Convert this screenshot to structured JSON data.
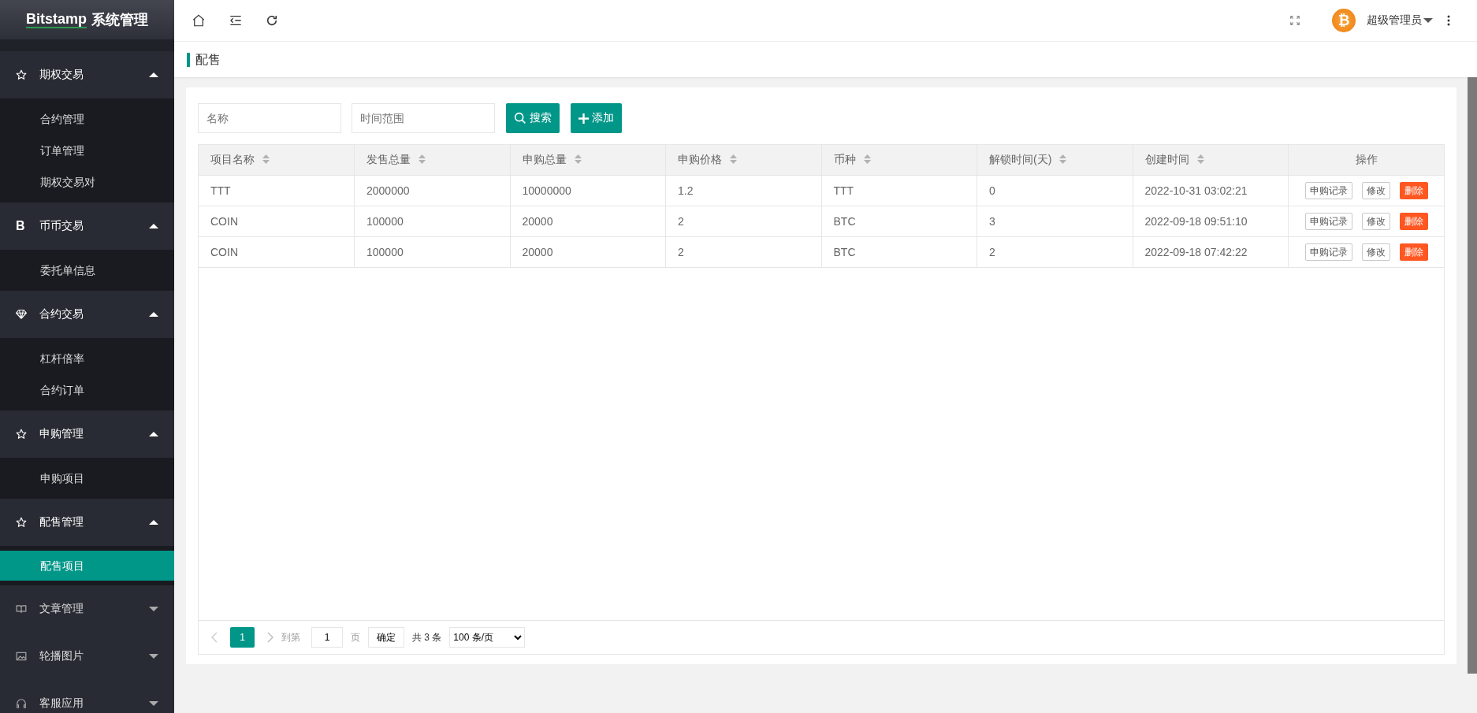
{
  "sidebar": {
    "logo": {
      "brand": "Bitstamp",
      "suffix": "系统管理"
    },
    "groups": [
      {
        "label": "期权交易",
        "kind": "star",
        "expanded": true,
        "children": [
          {
            "label": "合约管理",
            "selected": false
          },
          {
            "label": "订单管理",
            "selected": false
          },
          {
            "label": "期权交易对",
            "selected": false
          }
        ]
      },
      {
        "label": "币币交易",
        "kind": "letter",
        "icon_text": "B",
        "expanded": true,
        "children": [
          {
            "label": "委托单信息",
            "selected": false
          }
        ]
      },
      {
        "label": "合约交易",
        "kind": "gem",
        "expanded": true,
        "children": [
          {
            "label": "杠杆倍率",
            "selected": false
          },
          {
            "label": "合约订单",
            "selected": false
          }
        ]
      },
      {
        "label": "申购管理",
        "kind": "star",
        "expanded": true,
        "children": [
          {
            "label": "申购项目",
            "selected": false
          }
        ]
      },
      {
        "label": "配售管理",
        "kind": "star",
        "expanded": true,
        "children": [
          {
            "label": "配售项目",
            "selected": true
          }
        ]
      },
      {
        "label": "文章管理",
        "kind": "book",
        "expanded": false
      },
      {
        "label": "轮播图片",
        "kind": "image",
        "expanded": false
      },
      {
        "label": "客服应用",
        "kind": "headset",
        "expanded": false
      }
    ]
  },
  "topbar": {
    "avatar_glyph": "₿",
    "username": "超级管理员"
  },
  "page_title": "配售",
  "filters": {
    "name_placeholder": "名称",
    "time_placeholder": "时间范围",
    "search_label": "搜索",
    "add_label": "添加"
  },
  "table": {
    "columns": [
      {
        "label": "项目名称",
        "sortable": true
      },
      {
        "label": "发售总量",
        "sortable": true
      },
      {
        "label": "申购总量",
        "sortable": true
      },
      {
        "label": "申购价格",
        "sortable": true
      },
      {
        "label": "币种",
        "sortable": true
      },
      {
        "label": "解锁时间(天)",
        "sortable": true
      },
      {
        "label": "创建时间",
        "sortable": true
      },
      {
        "label": "操作",
        "sortable": false
      }
    ],
    "rows": [
      {
        "cells": [
          "TTT",
          "2000000",
          "10000000",
          "1.2",
          "TTT",
          "0",
          "2022-10-31 03:02:21"
        ],
        "actions": [
          {
            "label": "申购记录",
            "kind": "outline"
          },
          {
            "label": "修改",
            "kind": "outline"
          },
          {
            "label": "删除",
            "kind": "danger"
          }
        ]
      },
      {
        "cells": [
          "COIN",
          "100000",
          "20000",
          "2",
          "BTC",
          "3",
          "2022-09-18 09:51:10"
        ],
        "actions": [
          {
            "label": "申购记录",
            "kind": "outline"
          },
          {
            "label": "修改",
            "kind": "outline"
          },
          {
            "label": "删除",
            "kind": "danger"
          }
        ]
      },
      {
        "cells": [
          "COIN",
          "100000",
          "20000",
          "2",
          "BTC",
          "2",
          "2022-09-18 07:42:22"
        ],
        "actions": [
          {
            "label": "申购记录",
            "kind": "outline"
          },
          {
            "label": "修改",
            "kind": "outline"
          },
          {
            "label": "删除",
            "kind": "danger"
          }
        ]
      }
    ]
  },
  "pagination": {
    "prev_disabled": true,
    "pages": [
      {
        "label": "1",
        "selected": true
      }
    ],
    "goto_label": "到第",
    "goto_value": "1",
    "page_unit": "页",
    "confirm_label": "确定",
    "total": "共 3 条",
    "page_size": "100 条/页"
  }
}
